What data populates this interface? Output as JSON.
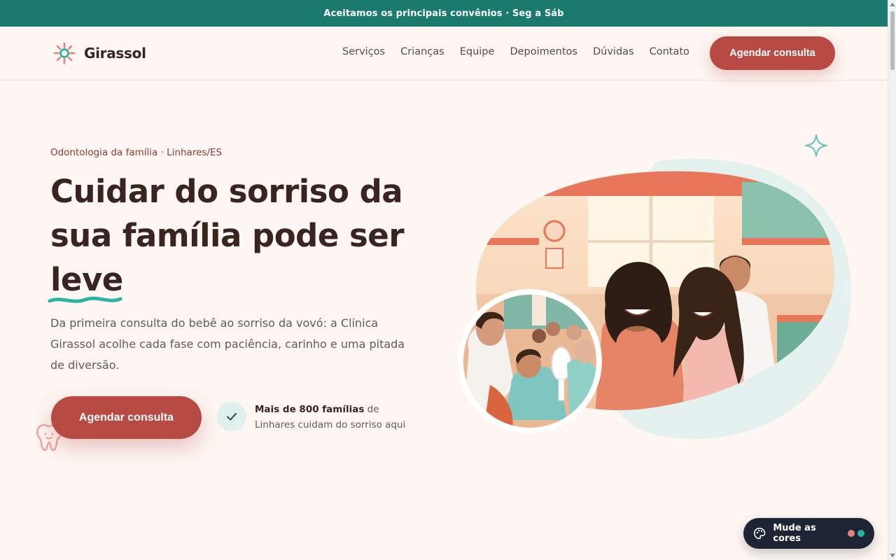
{
  "topbar": {
    "text": "Aceitamos os principais convênios · Seg a Sáb"
  },
  "header": {
    "brand": "Girassol",
    "nav": [
      "Serviços",
      "Crianças",
      "Equipe",
      "Depoimentos",
      "Dúvidas",
      "Contato"
    ],
    "cta_label": "Agendar consulta"
  },
  "hero": {
    "eyebrow": "Odontologia da família · Linhares/ES",
    "headline_line1": "Cuidar do sorriso da",
    "headline_line2": "sua família pode ser",
    "headline_accent": "leve",
    "lede": "Da primeira consulta do bebê ao sorriso da vovó: a Clínica Girassol acolhe cada fase com paciência, carinho e uma pitada de diversão.",
    "cta_label": "Agendar consulta",
    "proof_strong": "Mais de 800 famílias",
    "proof_rest": " de Linhares cuidam do sorriso aqui"
  },
  "widget": {
    "label": "Mude as cores"
  },
  "colors": {
    "brand_teal": "#1b7a6e",
    "brand_red": "#b84a44",
    "accent_teal": "#2bb3a3",
    "accent_coral": "#e8837a",
    "dark_pill": "#1d2433"
  },
  "icons": {
    "logo": "sun-icon",
    "check": "check-icon",
    "tooth": "tooth-icon",
    "sparkle": "sparkle-icon",
    "palette": "palette-icon"
  }
}
